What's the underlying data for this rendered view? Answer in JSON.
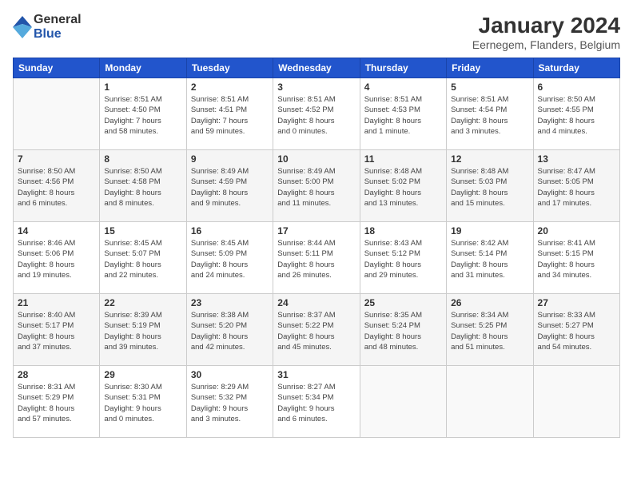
{
  "logo": {
    "general": "General",
    "blue": "Blue"
  },
  "title": "January 2024",
  "subtitle": "Eernegem, Flanders, Belgium",
  "weekdays": [
    "Sunday",
    "Monday",
    "Tuesday",
    "Wednesday",
    "Thursday",
    "Friday",
    "Saturday"
  ],
  "weeks": [
    [
      {
        "num": "",
        "info": ""
      },
      {
        "num": "1",
        "info": "Sunrise: 8:51 AM\nSunset: 4:50 PM\nDaylight: 7 hours\nand 58 minutes."
      },
      {
        "num": "2",
        "info": "Sunrise: 8:51 AM\nSunset: 4:51 PM\nDaylight: 7 hours\nand 59 minutes."
      },
      {
        "num": "3",
        "info": "Sunrise: 8:51 AM\nSunset: 4:52 PM\nDaylight: 8 hours\nand 0 minutes."
      },
      {
        "num": "4",
        "info": "Sunrise: 8:51 AM\nSunset: 4:53 PM\nDaylight: 8 hours\nand 1 minute."
      },
      {
        "num": "5",
        "info": "Sunrise: 8:51 AM\nSunset: 4:54 PM\nDaylight: 8 hours\nand 3 minutes."
      },
      {
        "num": "6",
        "info": "Sunrise: 8:50 AM\nSunset: 4:55 PM\nDaylight: 8 hours\nand 4 minutes."
      }
    ],
    [
      {
        "num": "7",
        "info": "Sunrise: 8:50 AM\nSunset: 4:56 PM\nDaylight: 8 hours\nand 6 minutes."
      },
      {
        "num": "8",
        "info": "Sunrise: 8:50 AM\nSunset: 4:58 PM\nDaylight: 8 hours\nand 8 minutes."
      },
      {
        "num": "9",
        "info": "Sunrise: 8:49 AM\nSunset: 4:59 PM\nDaylight: 8 hours\nand 9 minutes."
      },
      {
        "num": "10",
        "info": "Sunrise: 8:49 AM\nSunset: 5:00 PM\nDaylight: 8 hours\nand 11 minutes."
      },
      {
        "num": "11",
        "info": "Sunrise: 8:48 AM\nSunset: 5:02 PM\nDaylight: 8 hours\nand 13 minutes."
      },
      {
        "num": "12",
        "info": "Sunrise: 8:48 AM\nSunset: 5:03 PM\nDaylight: 8 hours\nand 15 minutes."
      },
      {
        "num": "13",
        "info": "Sunrise: 8:47 AM\nSunset: 5:05 PM\nDaylight: 8 hours\nand 17 minutes."
      }
    ],
    [
      {
        "num": "14",
        "info": "Sunrise: 8:46 AM\nSunset: 5:06 PM\nDaylight: 8 hours\nand 19 minutes."
      },
      {
        "num": "15",
        "info": "Sunrise: 8:45 AM\nSunset: 5:07 PM\nDaylight: 8 hours\nand 22 minutes."
      },
      {
        "num": "16",
        "info": "Sunrise: 8:45 AM\nSunset: 5:09 PM\nDaylight: 8 hours\nand 24 minutes."
      },
      {
        "num": "17",
        "info": "Sunrise: 8:44 AM\nSunset: 5:11 PM\nDaylight: 8 hours\nand 26 minutes."
      },
      {
        "num": "18",
        "info": "Sunrise: 8:43 AM\nSunset: 5:12 PM\nDaylight: 8 hours\nand 29 minutes."
      },
      {
        "num": "19",
        "info": "Sunrise: 8:42 AM\nSunset: 5:14 PM\nDaylight: 8 hours\nand 31 minutes."
      },
      {
        "num": "20",
        "info": "Sunrise: 8:41 AM\nSunset: 5:15 PM\nDaylight: 8 hours\nand 34 minutes."
      }
    ],
    [
      {
        "num": "21",
        "info": "Sunrise: 8:40 AM\nSunset: 5:17 PM\nDaylight: 8 hours\nand 37 minutes."
      },
      {
        "num": "22",
        "info": "Sunrise: 8:39 AM\nSunset: 5:19 PM\nDaylight: 8 hours\nand 39 minutes."
      },
      {
        "num": "23",
        "info": "Sunrise: 8:38 AM\nSunset: 5:20 PM\nDaylight: 8 hours\nand 42 minutes."
      },
      {
        "num": "24",
        "info": "Sunrise: 8:37 AM\nSunset: 5:22 PM\nDaylight: 8 hours\nand 45 minutes."
      },
      {
        "num": "25",
        "info": "Sunrise: 8:35 AM\nSunset: 5:24 PM\nDaylight: 8 hours\nand 48 minutes."
      },
      {
        "num": "26",
        "info": "Sunrise: 8:34 AM\nSunset: 5:25 PM\nDaylight: 8 hours\nand 51 minutes."
      },
      {
        "num": "27",
        "info": "Sunrise: 8:33 AM\nSunset: 5:27 PM\nDaylight: 8 hours\nand 54 minutes."
      }
    ],
    [
      {
        "num": "28",
        "info": "Sunrise: 8:31 AM\nSunset: 5:29 PM\nDaylight: 8 hours\nand 57 minutes."
      },
      {
        "num": "29",
        "info": "Sunrise: 8:30 AM\nSunset: 5:31 PM\nDaylight: 9 hours\nand 0 minutes."
      },
      {
        "num": "30",
        "info": "Sunrise: 8:29 AM\nSunset: 5:32 PM\nDaylight: 9 hours\nand 3 minutes."
      },
      {
        "num": "31",
        "info": "Sunrise: 8:27 AM\nSunset: 5:34 PM\nDaylight: 9 hours\nand 6 minutes."
      },
      {
        "num": "",
        "info": ""
      },
      {
        "num": "",
        "info": ""
      },
      {
        "num": "",
        "info": ""
      }
    ]
  ]
}
